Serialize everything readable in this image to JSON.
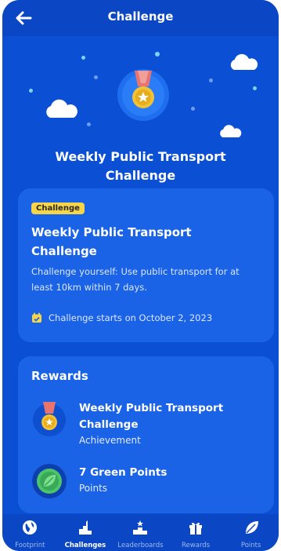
{
  "header": {
    "title": "Challenge",
    "back_icon": "arrow-left-icon"
  },
  "hero": {
    "title": "Weekly Public Transport Challenge",
    "medal_icon": "medal-icon"
  },
  "challenge_card": {
    "badge": "Challenge",
    "title": "Weekly Public Transport Challenge",
    "description": "Challenge yourself: Use public transport for at least 10km within 7 days.",
    "date_icon": "calendar-icon",
    "date_text": "Challenge starts on October 2, 2023"
  },
  "rewards": {
    "heading": "Rewards",
    "items": [
      {
        "icon": "medal-icon",
        "name": "Weekly Public Transport Challenge",
        "type": "Achievement"
      },
      {
        "icon": "leaf-coin-icon",
        "name": "7 Green Points",
        "type": "Points"
      }
    ]
  },
  "bottom_nav": {
    "items": [
      {
        "label": "Footprint",
        "icon": "globe-icon"
      },
      {
        "label": "Challenges",
        "icon": "challenge-icon"
      },
      {
        "label": "Leaderboards",
        "icon": "podium-icon"
      },
      {
        "label": "Rewards",
        "icon": "gift-icon"
      },
      {
        "label": "Points",
        "icon": "leaf-icon"
      }
    ],
    "active": "Challenges"
  },
  "colors": {
    "background": "#0a4fd4",
    "card": "#1a63e6",
    "badge": "#f7d548",
    "medal_gold": "#f3c234",
    "ribbon": "#e8736f"
  }
}
